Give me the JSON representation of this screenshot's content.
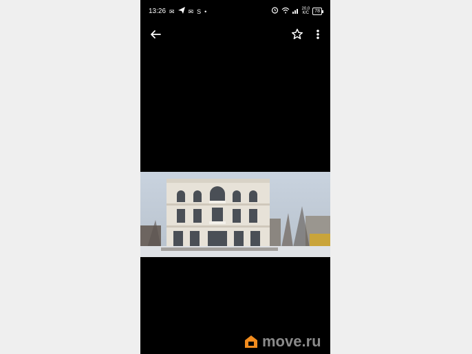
{
  "statusbar": {
    "time": "13:26",
    "left_icons": [
      "mail-icon",
      "telegram-icon",
      "mail-icon",
      "skype-icon",
      "dot-icon"
    ],
    "right_icons": [
      "alarm-icon",
      "wifi-icon",
      "signal-icon"
    ],
    "data_speed_top": "20,0",
    "data_speed_bottom": "К/С",
    "battery": "78"
  },
  "toolbar": {
    "back_icon": "arrow-left-icon",
    "favorite_icon": "star-outline-icon",
    "more_icon": "more-vertical-icon"
  },
  "photo": {
    "subject": "building-photo"
  },
  "watermark": {
    "brand": "move.ru",
    "logo_color": "#f28c1e"
  },
  "colors": {
    "background": "#efefef",
    "viewer_background": "#000000"
  }
}
